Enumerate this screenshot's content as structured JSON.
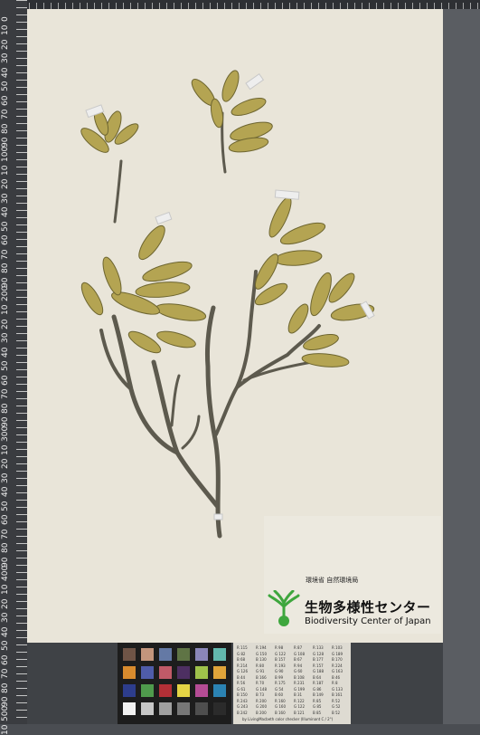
{
  "ruler": {
    "labels": [
      "0",
      "10",
      "20",
      "30",
      "40",
      "50",
      "60",
      "70",
      "80",
      "90",
      "100",
      "10",
      "20",
      "30",
      "40",
      "50",
      "60",
      "70",
      "80",
      "90",
      "200",
      "10",
      "20",
      "30",
      "40",
      "50",
      "60",
      "70",
      "80",
      "90",
      "300",
      "10",
      "20",
      "30",
      "40",
      "50",
      "60",
      "70",
      "80",
      "90",
      "400",
      "10",
      "20",
      "30",
      "40",
      "50",
      "60",
      "70",
      "80",
      "90",
      "500",
      "10"
    ]
  },
  "logo": {
    "small_text": "環境省 自然環境局",
    "japanese_name": "生物多様性センター",
    "english_name": "Biodiversity Center of Japan"
  },
  "color_chart": {
    "swatch_colors": [
      "#6f5446",
      "#c3957c",
      "#6479a5",
      "#5f7445",
      "#8a86b8",
      "#63b9ae",
      "#d88b2e",
      "#4f5ca9",
      "#c05a68",
      "#4d2f61",
      "#9fc24b",
      "#e0a43a",
      "#2d3d8c",
      "#4f9a4c",
      "#b22f36",
      "#e4d445",
      "#b54c95",
      "#2b83b3",
      "#f2f2f2",
      "#c7c7c7",
      "#a0a0a0",
      "#777777",
      "#4e4e4e",
      "#2b2b2b"
    ],
    "table_rows": [
      [
        "R 115",
        "R 194",
        "R 98",
        "R 87",
        "R 133",
        "R 103"
      ],
      [
        "G 82",
        "G 150",
        "G 122",
        "G 108",
        "G 128",
        "G 189"
      ],
      [
        "B 68",
        "B 130",
        "B 157",
        "B 67",
        "B 177",
        "B 170"
      ],
      [
        "R 214",
        "R 80",
        "R 193",
        "R 94",
        "R 157",
        "R 224"
      ],
      [
        "G 126",
        "G 91",
        "G 90",
        "G 60",
        "G 188",
        "G 163"
      ],
      [
        "B 44",
        "B 166",
        "B 99",
        "B 108",
        "B 64",
        "B 46"
      ],
      [
        "R 56",
        "R 70",
        "R 175",
        "R 231",
        "R 187",
        "R 8"
      ],
      [
        "G 61",
        "G 148",
        "G 54",
        "G 199",
        "G 86",
        "G 133"
      ],
      [
        "B 150",
        "B 73",
        "B 60",
        "B 31",
        "B 149",
        "B 161"
      ],
      [
        "R 243",
        "R 200",
        "R 160",
        "R 122",
        "R 85",
        "R 52"
      ],
      [
        "G 243",
        "G 200",
        "G 160",
        "G 122",
        "G 85",
        "G 52"
      ],
      [
        "B 242",
        "B 200",
        "B 160",
        "B 121",
        "B 85",
        "B 52"
      ]
    ],
    "note": "by LivingMacbeth color checker (Illuminant C / 2°)"
  }
}
